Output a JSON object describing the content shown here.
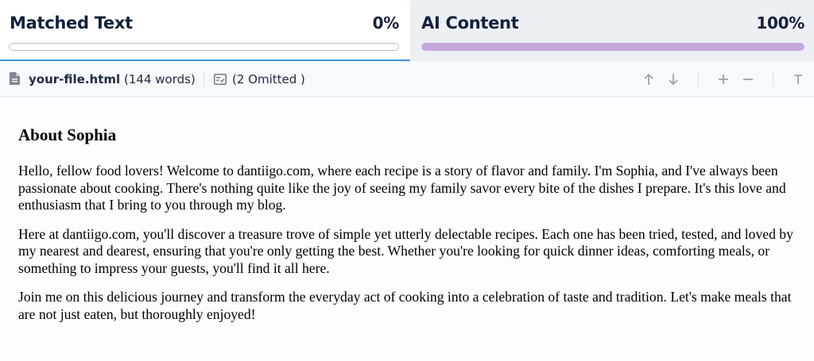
{
  "tabs": {
    "matched": {
      "title": "Matched Text",
      "percent_label": "0%",
      "percent": 0
    },
    "ai": {
      "title": "AI Content",
      "percent_label": "100%",
      "percent": 100
    }
  },
  "toolbar": {
    "file_name": "your-file.html",
    "word_count": "(144 words)",
    "omitted": "(2 Omitted )"
  },
  "document": {
    "heading": "About Sophia",
    "paragraphs": [
      "Hello, fellow food lovers! Welcome to dantiigo.com, where each recipe is a story of flavor and family. I'm Sophia, and I've always been passionate about cooking. There's nothing quite like the joy of seeing my family savor every bite of the dishes I prepare. It's this love and enthusiasm that I bring to you through my blog.",
      "Here at dantiigo.com, you'll discover a treasure trove of simple yet utterly delectable recipes. Each one has been tried, tested, and loved by my nearest and dearest, ensuring that you're only getting the best. Whether you're looking for quick dinner ideas, comforting meals, or something to impress your guests, you'll find it all here.",
      "Join me on this delicious journey and transform the everyday act of cooking into a celebration of taste and tradition. Let's make meals that are not just eaten, but thoroughly enjoyed!"
    ]
  },
  "icons": {
    "file": "file-icon",
    "omitted": "omitted-list-icon",
    "up": "arrow-up-icon",
    "down": "arrow-down-icon",
    "plus": "plus-icon",
    "minus": "minus-icon",
    "text": "text-size-icon"
  },
  "colors": {
    "accent_blue": "#3f8fe0",
    "ai_bar": "#c3a8dd",
    "title_text": "#14213d"
  }
}
